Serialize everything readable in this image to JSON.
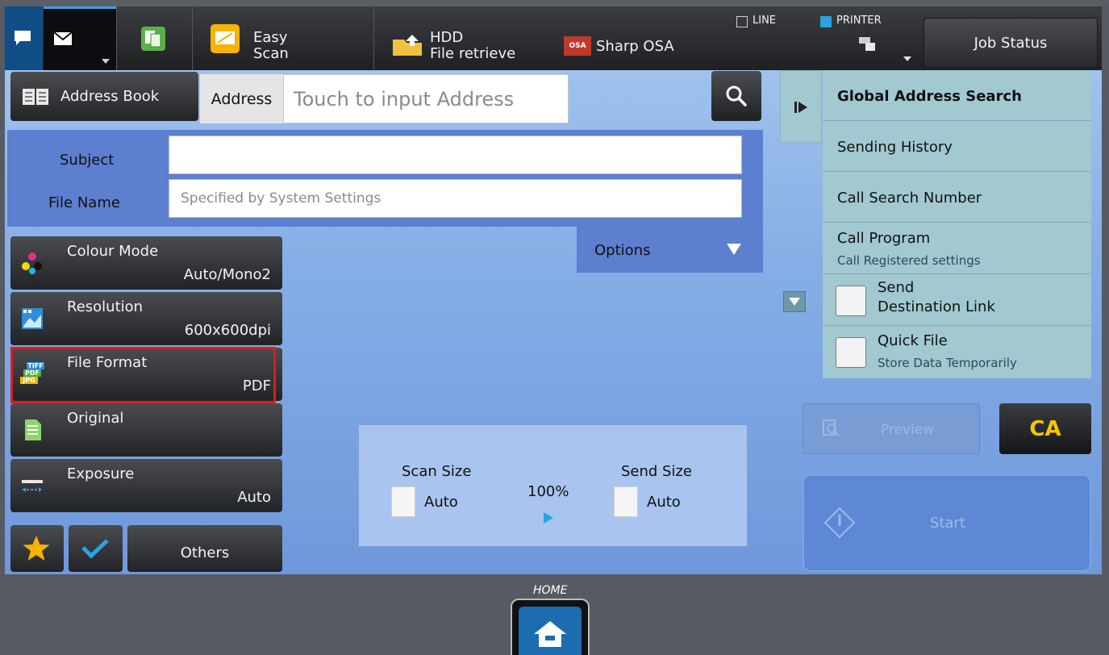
{
  "topbar": {
    "easy_scan_1": "Easy",
    "easy_scan_2": "Scan",
    "hdd_1": "HDD",
    "hdd_2": "File retrieve",
    "sharp_osa": "Sharp OSA",
    "osa_logo": "OSA",
    "line": "LINE",
    "printer": "PRINTER",
    "job_status": "Job Status"
  },
  "address": {
    "address_book": "Address Book",
    "label": "Address",
    "placeholder": "Touch to input Address"
  },
  "fields": {
    "subject_label": "Subject",
    "subject_value": "",
    "file_name_label": "File Name",
    "file_name_placeholder": "Specified by System Settings",
    "options": "Options"
  },
  "settings": [
    {
      "title": "Colour Mode",
      "value": "Auto/Mono2"
    },
    {
      "title": "Resolution",
      "value": "600x600dpi"
    },
    {
      "title": "File Format",
      "value": "PDF"
    },
    {
      "title": "Original",
      "value": ""
    },
    {
      "title": "Exposure",
      "value": "Auto"
    }
  ],
  "format_icon": [
    "TIFF",
    "PDF",
    "JPG"
  ],
  "others": "Others",
  "scan": {
    "scan_size_label": "Scan Size",
    "scan_size_value": "Auto",
    "ratio": "100%",
    "send_size_label": "Send Size",
    "send_size_value": "Auto"
  },
  "right_menu": {
    "global_search": "Global Address Search",
    "sending_history": "Sending History",
    "call_search_number": "Call Search Number",
    "call_program": "Call Program",
    "call_program_sub": "Call Registered settings",
    "send_link_1": "Send",
    "send_link_2": "Destination Link",
    "quick_file": "Quick File",
    "quick_file_sub": "Store Data Temporarily"
  },
  "actions": {
    "preview": "Preview",
    "ca": "CA",
    "start": "Start"
  },
  "home": "HOME",
  "colors": {
    "highlight": "#d72020",
    "ca_text": "#f7c600",
    "panel_bg": "#86aee6"
  }
}
